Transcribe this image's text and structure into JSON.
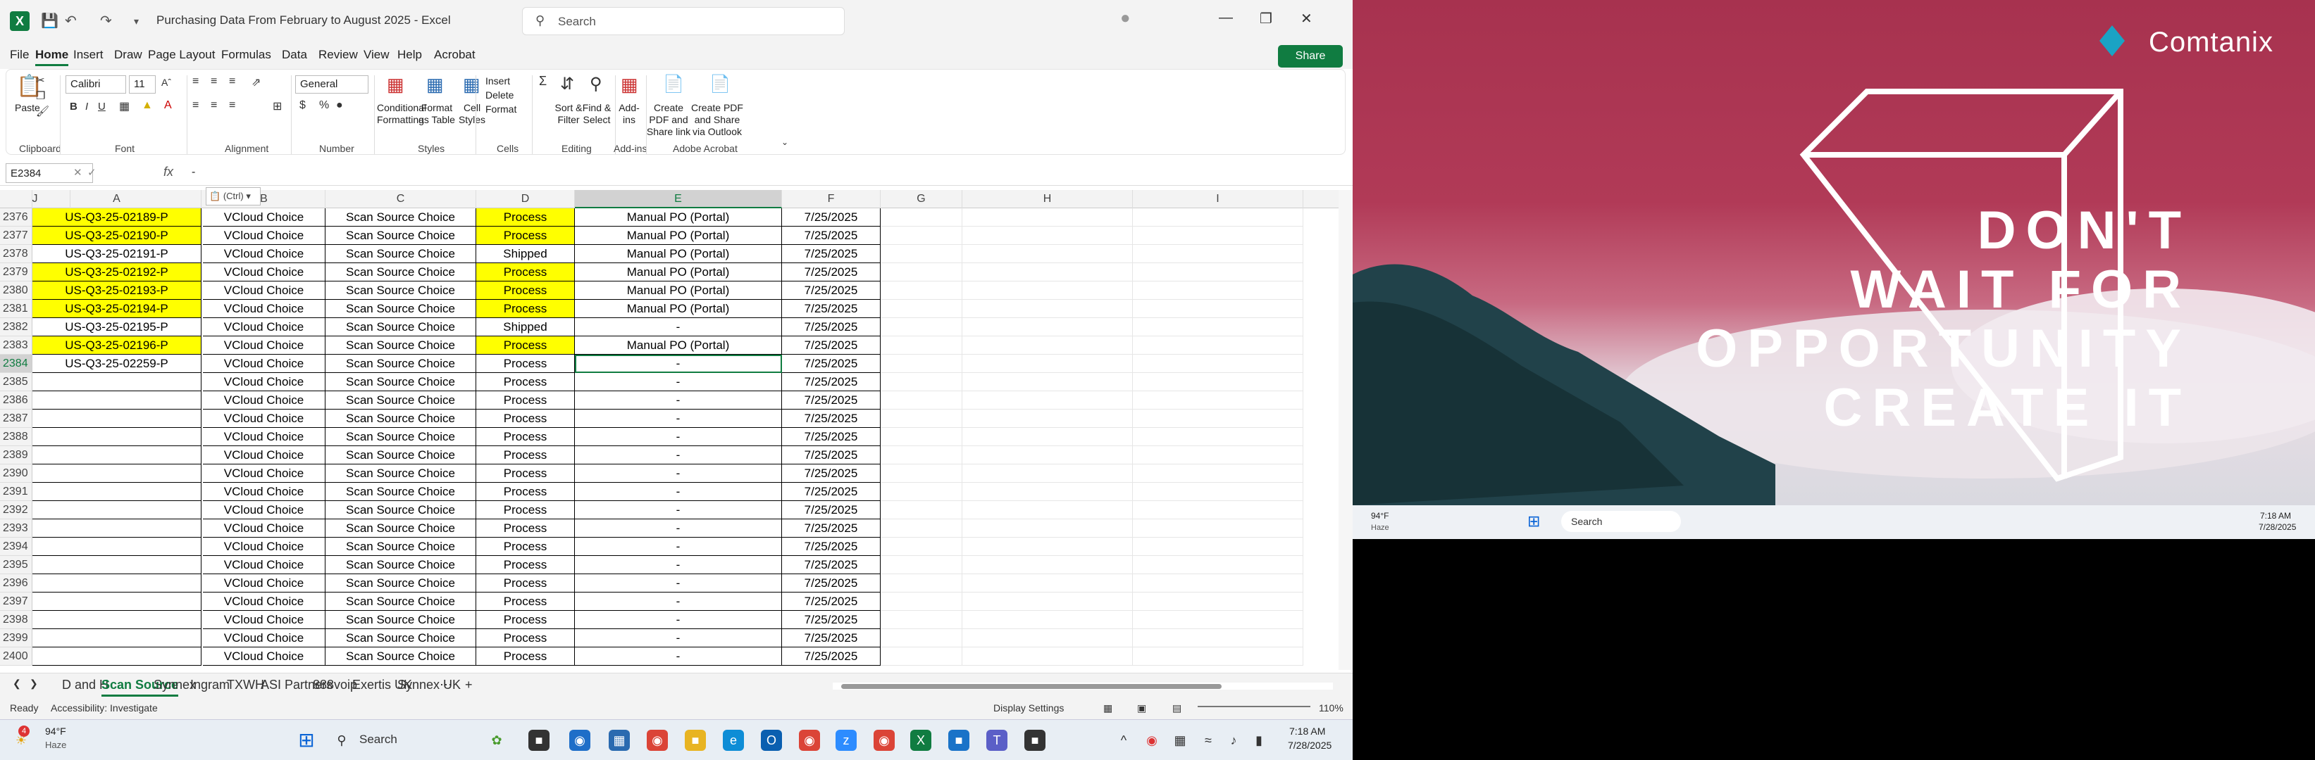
{
  "window": {
    "title": "Purchasing Data From February to August 2025  -  Excel",
    "search": "Search",
    "share": "Share"
  },
  "menu": [
    "File",
    "Home",
    "Insert",
    "Draw",
    "Page Layout",
    "Formulas",
    "Data",
    "Review",
    "View",
    "Help",
    "Acrobat"
  ],
  "ribbon": {
    "paste": "Paste",
    "font_name": "Calibri",
    "font_size": "11",
    "number_format": "General",
    "conditional": "Conditional Formatting",
    "format_table": "Format as Table",
    "cell_styles": "Cell Styles",
    "insert": "Insert",
    "delete": "Delete",
    "format": "Format",
    "sort": "Sort & Filter",
    "find": "Find & Select",
    "addins": "Add-ins",
    "pdf_link": "Create PDF and Share link",
    "pdf_outlook": "Create PDF and Share via Outlook",
    "groups": [
      "Clipboard",
      "Font",
      "Alignment",
      "Number",
      "Styles",
      "Cells",
      "Editing",
      "Add-ins",
      "Adobe Acrobat"
    ]
  },
  "formula_bar": {
    "name_box": "E2384",
    "fx": "fx",
    "value": "-"
  },
  "columns": [
    "A",
    "B",
    "C",
    "D",
    "E",
    "F",
    "G",
    "H",
    "I",
    "J"
  ],
  "rows": [
    {
      "n": "2376",
      "a": "US-Q3-25-02189-P",
      "b": "VCloud Choice",
      "c": "Scan Source Choice",
      "d": "Process",
      "e": "Manual PO (Portal)",
      "f": "7/25/2025",
      "ya": true,
      "yd": true
    },
    {
      "n": "2377",
      "a": "US-Q3-25-02190-P",
      "b": "VCloud Choice",
      "c": "Scan Source Choice",
      "d": "Process",
      "e": "Manual PO (Portal)",
      "f": "7/25/2025",
      "ya": true,
      "yd": true
    },
    {
      "n": "2378",
      "a": "US-Q3-25-02191-P",
      "b": "VCloud Choice",
      "c": "Scan Source Choice",
      "d": "Shipped",
      "e": "Manual PO (Portal)",
      "f": "7/25/2025",
      "ya": false,
      "yd": false
    },
    {
      "n": "2379",
      "a": "US-Q3-25-02192-P",
      "b": "VCloud Choice",
      "c": "Scan Source Choice",
      "d": "Process",
      "e": "Manual PO (Portal)",
      "f": "7/25/2025",
      "ya": true,
      "yd": true
    },
    {
      "n": "2380",
      "a": "US-Q3-25-02193-P",
      "b": "VCloud Choice",
      "c": "Scan Source Choice",
      "d": "Process",
      "e": "Manual PO (Portal)",
      "f": "7/25/2025",
      "ya": true,
      "yd": true
    },
    {
      "n": "2381",
      "a": "US-Q3-25-02194-P",
      "b": "VCloud Choice",
      "c": "Scan Source Choice",
      "d": "Process",
      "e": "Manual PO (Portal)",
      "f": "7/25/2025",
      "ya": true,
      "yd": true
    },
    {
      "n": "2382",
      "a": "US-Q3-25-02195-P",
      "b": "VCloud Choice",
      "c": "Scan Source Choice",
      "d": "Shipped",
      "e": "-",
      "f": "7/25/2025",
      "ya": false,
      "yd": false
    },
    {
      "n": "2383",
      "a": "US-Q3-25-02196-P",
      "b": "VCloud Choice",
      "c": "Scan Source Choice",
      "d": "Process",
      "e": "Manual PO (Portal)",
      "f": "7/25/2025",
      "ya": true,
      "yd": true
    },
    {
      "n": "2384",
      "a": "US-Q3-25-02259-P",
      "b": "VCloud Choice",
      "c": "Scan Source Choice",
      "d": "Process",
      "e": "-",
      "f": "7/25/2025",
      "ya": false,
      "yd": false
    },
    {
      "n": "2385",
      "a": "",
      "b": "VCloud Choice",
      "c": "Scan Source Choice",
      "d": "Process",
      "e": "-",
      "f": "7/25/2025",
      "ya": false,
      "yd": false
    },
    {
      "n": "2386",
      "a": "",
      "b": "VCloud Choice",
      "c": "Scan Source Choice",
      "d": "Process",
      "e": "-",
      "f": "7/25/2025",
      "ya": false,
      "yd": false
    },
    {
      "n": "2387",
      "a": "",
      "b": "VCloud Choice",
      "c": "Scan Source Choice",
      "d": "Process",
      "e": "-",
      "f": "7/25/2025",
      "ya": false,
      "yd": false
    },
    {
      "n": "2388",
      "a": "",
      "b": "VCloud Choice",
      "c": "Scan Source Choice",
      "d": "Process",
      "e": "-",
      "f": "7/25/2025",
      "ya": false,
      "yd": false
    },
    {
      "n": "2389",
      "a": "",
      "b": "VCloud Choice",
      "c": "Scan Source Choice",
      "d": "Process",
      "e": "-",
      "f": "7/25/2025",
      "ya": false,
      "yd": false
    },
    {
      "n": "2390",
      "a": "",
      "b": "VCloud Choice",
      "c": "Scan Source Choice",
      "d": "Process",
      "e": "-",
      "f": "7/25/2025",
      "ya": false,
      "yd": false
    },
    {
      "n": "2391",
      "a": "",
      "b": "VCloud Choice",
      "c": "Scan Source Choice",
      "d": "Process",
      "e": "-",
      "f": "7/25/2025",
      "ya": false,
      "yd": false
    },
    {
      "n": "2392",
      "a": "",
      "b": "VCloud Choice",
      "c": "Scan Source Choice",
      "d": "Process",
      "e": "-",
      "f": "7/25/2025",
      "ya": false,
      "yd": false
    },
    {
      "n": "2393",
      "a": "",
      "b": "VCloud Choice",
      "c": "Scan Source Choice",
      "d": "Process",
      "e": "-",
      "f": "7/25/2025",
      "ya": false,
      "yd": false
    },
    {
      "n": "2394",
      "a": "",
      "b": "VCloud Choice",
      "c": "Scan Source Choice",
      "d": "Process",
      "e": "-",
      "f": "7/25/2025",
      "ya": false,
      "yd": false
    },
    {
      "n": "2395",
      "a": "",
      "b": "VCloud Choice",
      "c": "Scan Source Choice",
      "d": "Process",
      "e": "-",
      "f": "7/25/2025",
      "ya": false,
      "yd": false
    },
    {
      "n": "2396",
      "a": "",
      "b": "VCloud Choice",
      "c": "Scan Source Choice",
      "d": "Process",
      "e": "-",
      "f": "7/25/2025",
      "ya": false,
      "yd": false
    },
    {
      "n": "2397",
      "a": "",
      "b": "VCloud Choice",
      "c": "Scan Source Choice",
      "d": "Process",
      "e": "-",
      "f": "7/25/2025",
      "ya": false,
      "yd": false
    },
    {
      "n": "2398",
      "a": "",
      "b": "VCloud Choice",
      "c": "Scan Source Choice",
      "d": "Process",
      "e": "-",
      "f": "7/25/2025",
      "ya": false,
      "yd": false
    },
    {
      "n": "2399",
      "a": "",
      "b": "VCloud Choice",
      "c": "Scan Source Choice",
      "d": "Process",
      "e": "-",
      "f": "7/25/2025",
      "ya": false,
      "yd": false
    },
    {
      "n": "2400",
      "a": "",
      "b": "VCloud Choice",
      "c": "Scan Source Choice",
      "d": "Process",
      "e": "-",
      "f": "7/25/2025",
      "ya": false,
      "yd": false
    }
  ],
  "paste_options": "(Ctrl)",
  "sheets": [
    "D and H",
    "Scan Source",
    "Synnex",
    "Ingram",
    "TXWH",
    "ASI Partners",
    "888voip",
    "Exertis UK",
    "Synnex UK"
  ],
  "status": {
    "ready": "Ready",
    "accessibility": "Accessibility: Investigate",
    "display": "Display Settings",
    "zoom": "110%"
  },
  "taskbar": {
    "temp": "94°F",
    "weather": "Haze",
    "badge": "4",
    "search": "Search",
    "time": "7:18 AM",
    "date": "7/28/2025"
  },
  "wallpaper": {
    "brand": "Comtanix",
    "lines": [
      "DON'T",
      "WAIT FOR",
      "OPPORTUNITY",
      "CREATE IT"
    ]
  },
  "taskbar2": {
    "temp": "94°F",
    "weather": "Haze",
    "search": "Search",
    "time": "7:18 AM",
    "date": "7/28/2025"
  }
}
